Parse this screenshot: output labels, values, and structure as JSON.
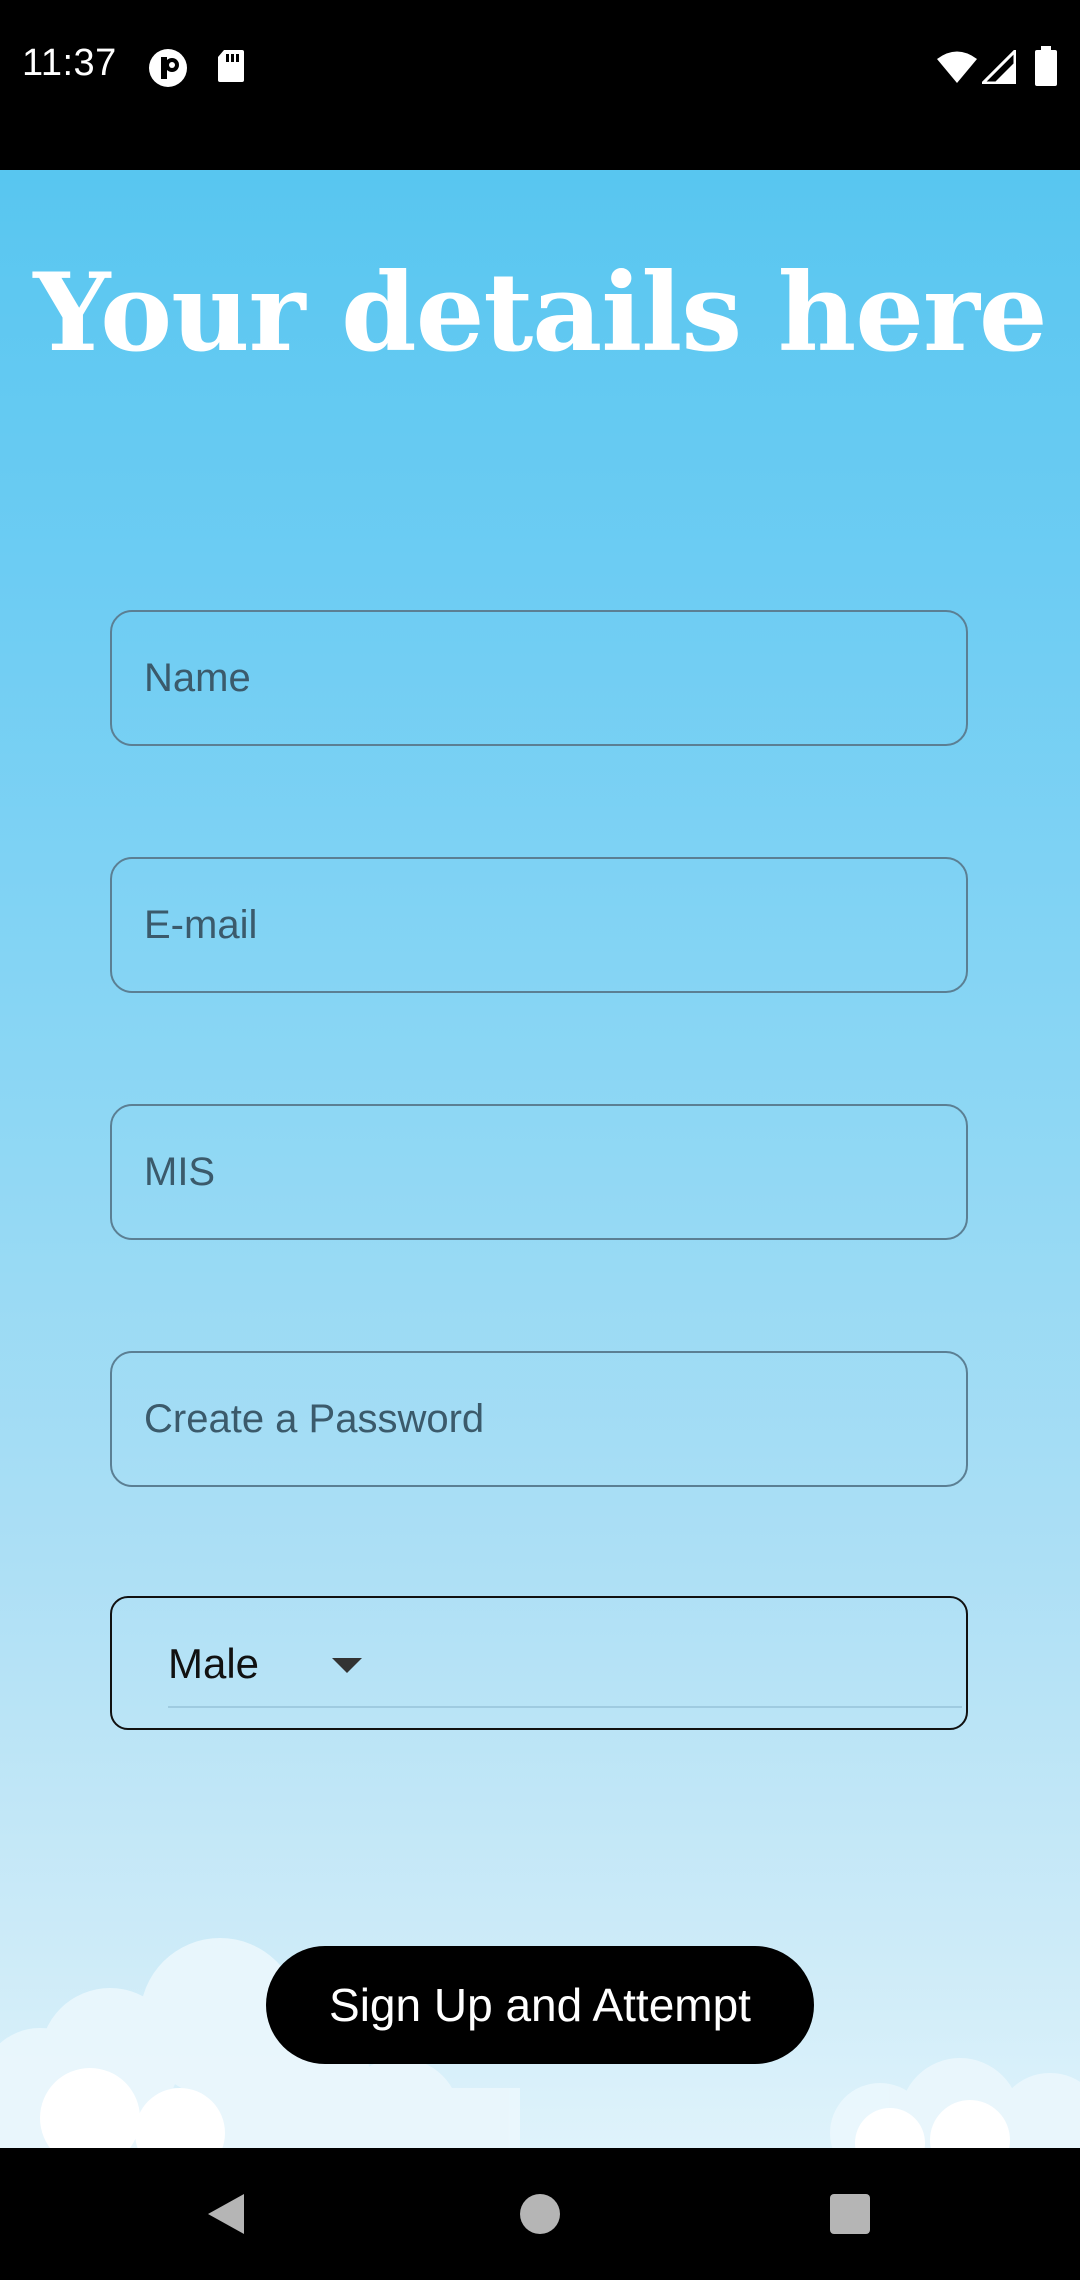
{
  "status_bar": {
    "time": "11:37",
    "icons": [
      "p-circle-icon",
      "sd-card-icon",
      "wifi-icon",
      "signal-icon",
      "battery-icon"
    ]
  },
  "page": {
    "title": "Your details here"
  },
  "form": {
    "name_placeholder": "Name",
    "email_placeholder": "E-mail",
    "mis_placeholder": "MIS",
    "password_placeholder": "Create a Password",
    "gender_selected": "Male"
  },
  "actions": {
    "signup_label": "Sign Up and Attempt"
  },
  "nav_bar": {
    "buttons": [
      "back-icon",
      "home-icon",
      "recents-icon"
    ]
  },
  "colors": {
    "background_top": "#58c6f0",
    "background_bottom": "#dff3fb",
    "field_border": "#5b7f93",
    "button": "#000000",
    "title": "#ffffff"
  }
}
